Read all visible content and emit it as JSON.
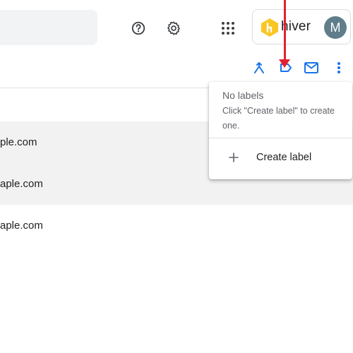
{
  "header": {
    "icons": [
      "help-icon",
      "settings-icon",
      "apps-grid-icon"
    ],
    "hiver": {
      "logo_letter": "h",
      "brand_text": "hiver",
      "avatar_initial": "M",
      "avatar_color": "#607d8b",
      "logo_color": "#f9c623"
    }
  },
  "toolbar": {
    "icons": [
      "split-icon",
      "label-icon",
      "mail-icon",
      "more-vert-icon"
    ],
    "accent": "#1a73e8"
  },
  "list": {
    "rows": [
      {
        "email": "ple.com"
      },
      {
        "email": "aple.com"
      },
      {
        "email": "aple.com"
      }
    ]
  },
  "label_menu": {
    "title": "No labels",
    "description": "Click \"Create label\" to create one.",
    "create_label": "Create label"
  },
  "annotation": {
    "arrow_color": "#e5202e"
  }
}
